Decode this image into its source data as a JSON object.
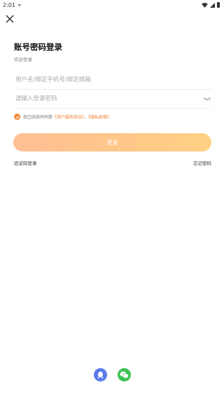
{
  "status_bar": {
    "time": "2:01",
    "notification_glyph": "ᯤ"
  },
  "header": {
    "title": "账号密码登录",
    "subtitle": "欢迎登录"
  },
  "form": {
    "username_placeholder": "用户名/绑定手机号/绑定邮箱",
    "password_placeholder": "请输入登录密码"
  },
  "agreement": {
    "prefix": "我已阅读并同意",
    "user_agreement": "《用户服务协议》",
    "separator": "、",
    "privacy_policy": "《隐私政策》"
  },
  "login_button": "登录",
  "links": {
    "sms_login": "验证码登录",
    "forgot_password": "忘记密码"
  },
  "colors": {
    "accent": "#f07d2e",
    "button_gradient_start": "#ffbf94",
    "button_gradient_end": "#ffd185",
    "qq": "#5a7bea",
    "wechat": "#3fc156"
  },
  "icons": [
    "close-icon",
    "eye-closed-icon",
    "check-icon",
    "qq-icon",
    "wechat-icon",
    "wifi-icon",
    "signal-icon",
    "battery-icon"
  ]
}
